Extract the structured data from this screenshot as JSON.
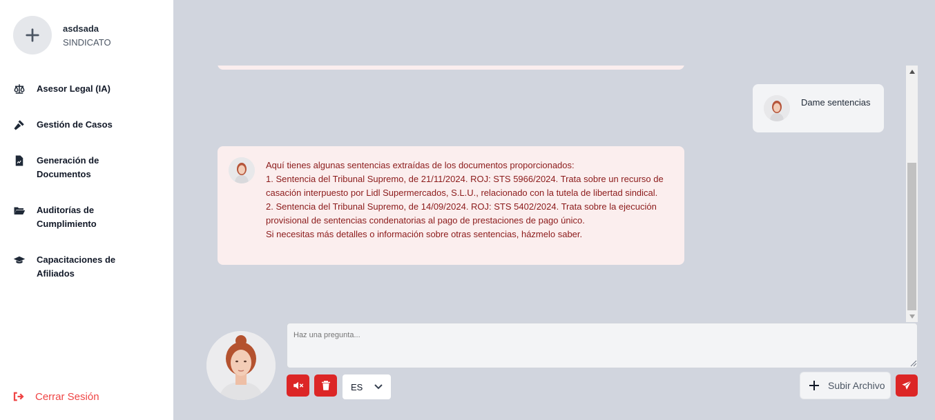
{
  "profile": {
    "name": "asdsada",
    "role": "SINDICATO"
  },
  "nav": [
    {
      "label": "Asesor Legal (IA)",
      "icon": "scale-icon"
    },
    {
      "label": "Gestión de Casos",
      "icon": "gavel-icon"
    },
    {
      "label": "Generación de Documentos",
      "icon": "document-icon"
    },
    {
      "label": "Auditorías de Cumplimiento",
      "icon": "folder-open-icon"
    },
    {
      "label": "Capacitaciones de Afiliados",
      "icon": "graduation-cap-icon"
    }
  ],
  "logout": {
    "label": "Cerrar Sesión"
  },
  "chat": {
    "user_message": "Dame sentencias",
    "bot_lines": [
      "Aquí tienes algunas sentencias extraídas de los documentos proporcionados:",
      "1. Sentencia del Tribunal Supremo, de 21/11/2024. ROJ: STS 5966/2024. Trata sobre un recurso de casación interpuesto por Lidl Supermercados, S.L.U., relacionado con la tutela de libertad sindical.",
      "2. Sentencia del Tribunal Supremo, de 14/09/2024. ROJ: STS 5402/2024. Trata sobre la ejecución provisional de sentencias condenatorias al pago de prestaciones de pago único.",
      "Si necesitas más detalles o información sobre otras sentencias, házmelo saber."
    ]
  },
  "composer": {
    "placeholder": "Haz una pregunta...",
    "language": "ES",
    "upload_label": "Subir Archivo"
  },
  "colors": {
    "accent": "#dc2626",
    "bot_bubble": "#fbeeee",
    "bot_text": "#8b1a1a",
    "logout": "#ef4444"
  }
}
